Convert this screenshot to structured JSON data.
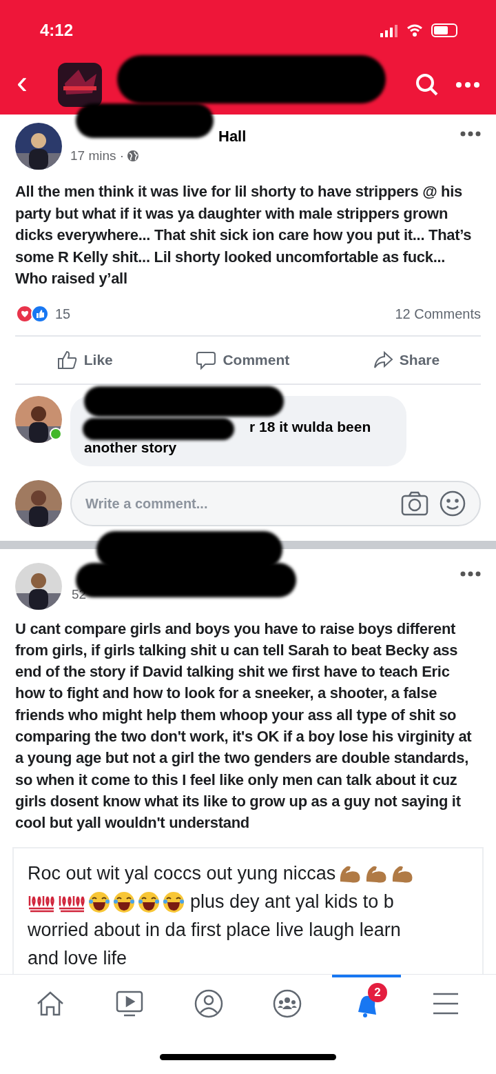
{
  "status_bar": {
    "time": "4:12"
  },
  "header": {
    "back": "‹"
  },
  "posts": [
    {
      "author_fragment": "Hall",
      "time": "17 mins",
      "time_separator": "·",
      "text": "All the men think it was live for lil shorty to have strippers @ his party but what if it was ya daughter with male strippers grown dicks everywhere... That shit sick ion care how you put it... That’s some R Kelly shit... Lil shorty looked uncomfortable as fuck... Who raised y’all",
      "reaction_count": "15",
      "comments_count": "12 Comments",
      "actions": [
        "Like",
        "Comment",
        "Share"
      ],
      "comment": {
        "text": "r 18 it wulda been",
        "text_continued": "another story",
        "online": true
      },
      "composer": {
        "placeholder": "Write a comment..."
      }
    },
    {
      "time": "52",
      "text": "U cant compare girls and boys you have to raise boys different from girls, if girls talking shit u can tell Sarah to beat Becky ass end of the story if David talking shit we first have to teach Eric how to fight and how to look for a sneeker, a shooter, a false friends who might help them whoop your ass all type of shit so comparing the two don't work, it's OK if a boy lose his virginity at a young age but not a girl the two genders are double standards, so when it come to this I feel like only men can talk about it cuz girls dosent know what its like to grow up as a guy not saying it cool but yall wouldn't understand",
      "shared": {
        "line1": "Roc out wit yal coccs out yung niccas",
        "line2": "plus dey ant yal kids to b",
        "line3": "worried about in da first place live laugh learn",
        "line4": "and love life"
      }
    }
  ],
  "tab_bar": {
    "tabs": [
      {
        "kind": "home",
        "selected": false
      },
      {
        "kind": "video",
        "selected": false
      },
      {
        "kind": "profile",
        "selected": false
      },
      {
        "kind": "groups",
        "selected": false
      },
      {
        "kind": "notifications",
        "selected": true,
        "badge": "2"
      },
      {
        "kind": "menu",
        "selected": false
      }
    ]
  }
}
